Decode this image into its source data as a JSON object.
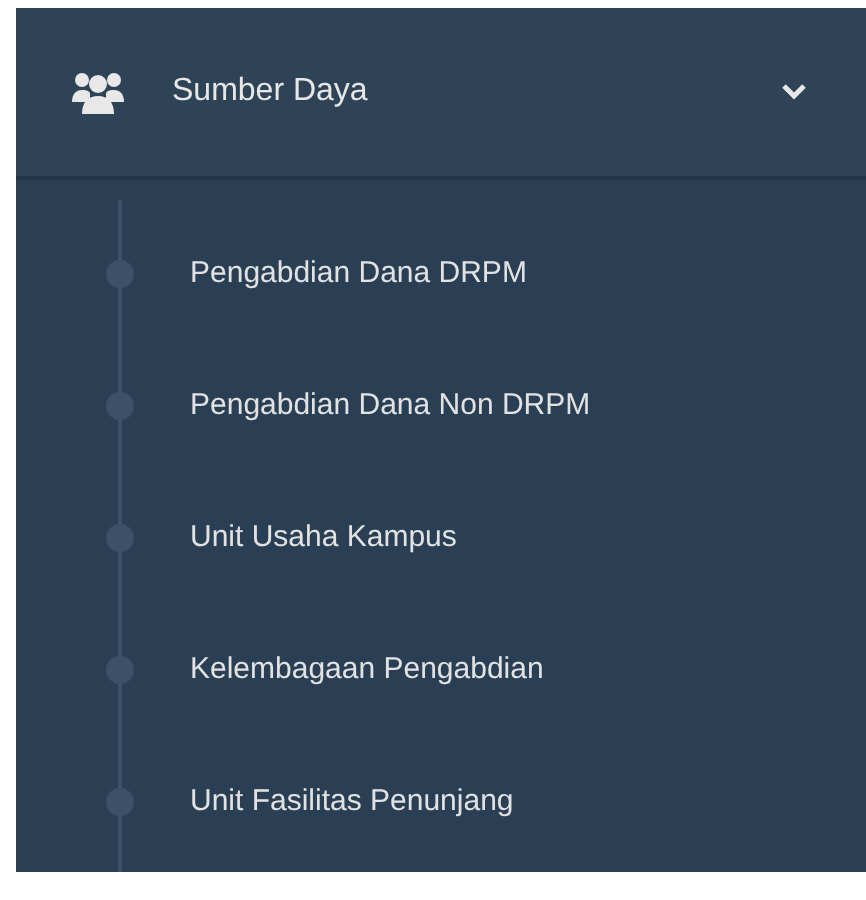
{
  "menu": {
    "label": "Sumber Daya",
    "expanded": true,
    "items": [
      {
        "label": "Pengabdian Dana DRPM"
      },
      {
        "label": "Pengabdian Dana Non DRPM"
      },
      {
        "label": "Unit Usaha Kampus"
      },
      {
        "label": "Kelembagaan Pengabdian"
      },
      {
        "label": "Unit Fasilitas Penunjang"
      }
    ]
  }
}
